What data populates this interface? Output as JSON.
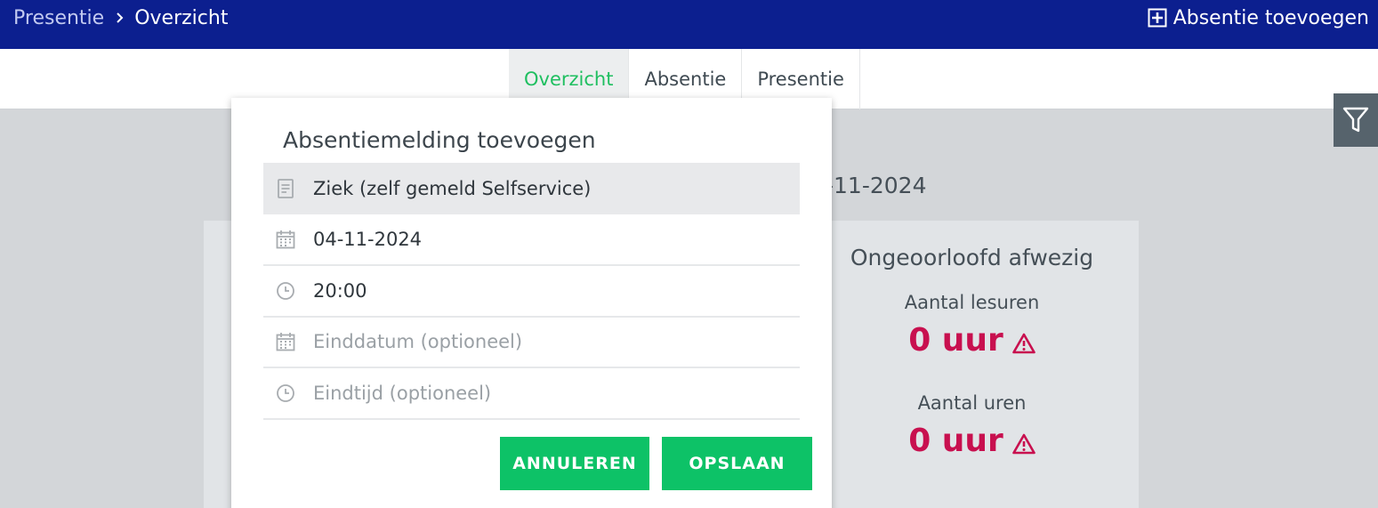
{
  "header": {
    "breadcrumb_root": "Presentie",
    "breadcrumb_current": "Overzicht",
    "add_absence_label": "Absentie toevoegen"
  },
  "tabs": [
    {
      "label": "Overzicht",
      "active": true
    },
    {
      "label": "Absentie",
      "active": false
    },
    {
      "label": "Presentie",
      "active": false
    }
  ],
  "background": {
    "date_fragment": "-11-2024",
    "unexcused": {
      "heading": "Ongeoorloofd afwezig",
      "lessons_label": "Aantal lesuren",
      "lessons_value": "0 uur",
      "hours_label": "Aantal uren",
      "hours_value": "0 uur"
    }
  },
  "dialog": {
    "title": "Absentiemelding toevoegen",
    "fields": {
      "reason": {
        "value": "Ziek (zelf gemeld Selfservice)",
        "icon": "document-icon"
      },
      "start_date": {
        "value": "04-11-2024",
        "icon": "calendar-icon"
      },
      "start_time": {
        "value": "20:00",
        "icon": "clock-icon"
      },
      "end_date": {
        "placeholder": "Einddatum (optioneel)",
        "icon": "calendar-icon"
      },
      "end_time": {
        "placeholder": "Eindtijd (optioneel)",
        "icon": "clock-icon"
      }
    },
    "cancel_label": "ANNULEREN",
    "save_label": "OPSLAAN"
  },
  "colors": {
    "header_bg": "#0c1f8f",
    "accent_green": "#0dc267",
    "tab_active": "#1fbf60",
    "alert_red": "#c8104f"
  }
}
